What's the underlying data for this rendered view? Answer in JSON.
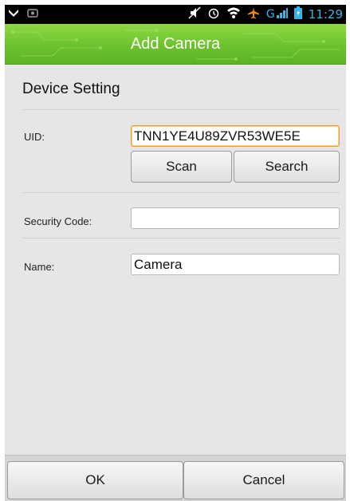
{
  "status_bar": {
    "time": "11:29",
    "network": "G",
    "icons": [
      "notification-icon",
      "gallery-icon",
      "mute-icon",
      "alarm-icon",
      "wifi-icon",
      "airplane-icon",
      "signal-icon",
      "battery-icon"
    ]
  },
  "header": {
    "title": "Add Camera"
  },
  "section": {
    "title": "Device Setting"
  },
  "form": {
    "uid_label": "UID:",
    "uid_value": "TNN1YE4U89ZVR53WE5E",
    "scan_label": "Scan",
    "search_label": "Search",
    "security_label": "Security Code:",
    "security_value": "",
    "name_label": "Name:",
    "name_value": "Camera"
  },
  "footer": {
    "ok_label": "OK",
    "cancel_label": "Cancel"
  },
  "colors": {
    "accent_green": "#6cc22e",
    "status_blue": "#33b5e5",
    "focus_orange": "#f0a12c"
  }
}
